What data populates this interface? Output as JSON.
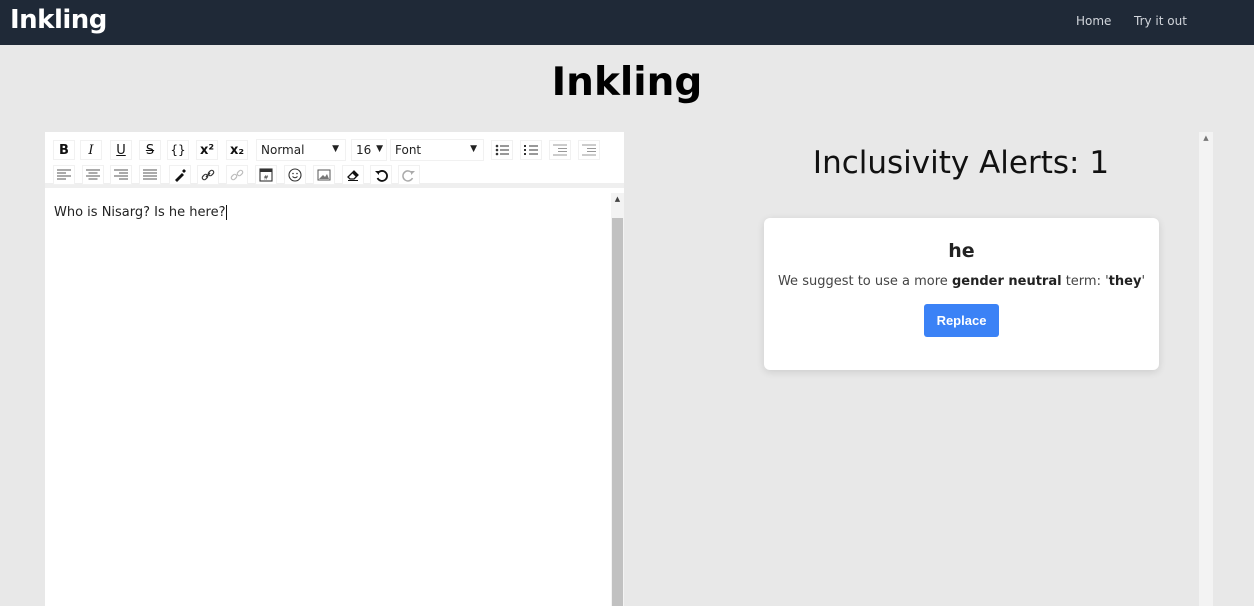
{
  "navbar": {
    "brand": "Inkling",
    "links": [
      "Home",
      "Try it out"
    ]
  },
  "page": {
    "title": "Inkling"
  },
  "toolbar": {
    "bold": "B",
    "italic": "I",
    "underline": "U",
    "strikethrough": "S",
    "code": "{}",
    "superscript": "x²",
    "subscript": "x₂",
    "block_type": "Normal",
    "font_size": "16",
    "font_family": "Font"
  },
  "editor": {
    "text": "Who is Nisarg? Is he here?"
  },
  "alerts": {
    "title": "Inclusivity Alerts: 1",
    "items": [
      {
        "word": "he",
        "message_prefix": "We suggest to use a more ",
        "message_emphasis": "gender neutral",
        "message_middle": " term: '",
        "suggestion": "they",
        "message_suffix": "'",
        "button_label": "Replace"
      }
    ]
  },
  "colors": {
    "navbar": "#1f2937",
    "background": "#e8e8e8",
    "accent": "#3b82f6"
  }
}
